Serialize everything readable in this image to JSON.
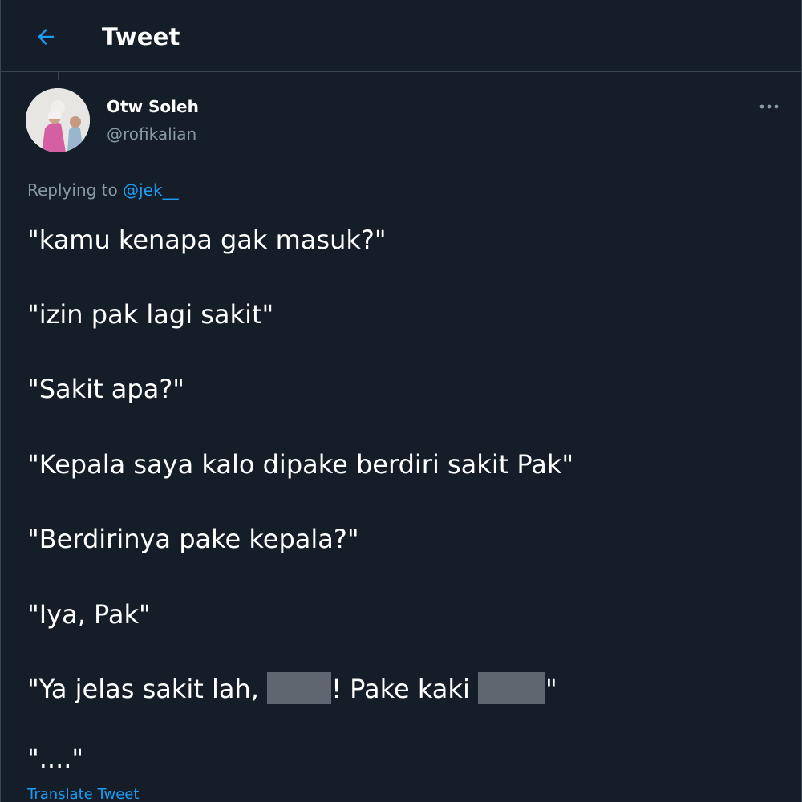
{
  "header": {
    "title": "Tweet",
    "back_icon": "arrow-left-icon",
    "accent_color": "#1d9bf0"
  },
  "tweet": {
    "author": {
      "name": "Otw Soleh",
      "handle": "@rofikalian"
    },
    "more_icon": "more-horizontal-icon",
    "replying_to": {
      "prefix": "Replying to",
      "handle": "@jek__"
    },
    "lines": [
      "\"kamu kenapa gak masuk?\"",
      "\"izin pak lagi sakit\"",
      "\"Sakit apa?\"",
      "\"Kepala saya kalo dipake berdiri sakit Pak\"",
      "\"Berdirinya pake kepala?\"",
      "\"Iya, Pak\""
    ],
    "censored_line": {
      "part1": "\"Ya jelas sakit lah, ",
      "part2": "! Pake kaki ",
      "part3": "\""
    },
    "last_line": "\"....\"",
    "translate_label": "Translate Tweet"
  }
}
